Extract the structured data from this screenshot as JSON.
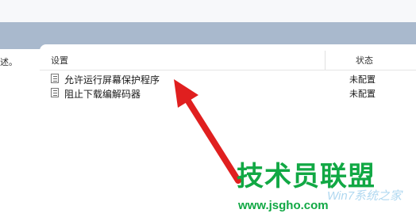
{
  "left": {
    "text": "述。"
  },
  "columns": {
    "setting": "设置",
    "state": "状态"
  },
  "rows": [
    {
      "name": "允许运行屏幕保护程序",
      "state": "未配置"
    },
    {
      "name": "阻止下载编解码器",
      "state": "未配置"
    }
  ],
  "watermark": {
    "title": "技术员联盟",
    "url": "www.jsgho.com",
    "subtitle": "Win7系统之家"
  },
  "colors": {
    "arrow": "#e01f1f",
    "watermark": "#11a844",
    "band": "#a9b9cd"
  }
}
